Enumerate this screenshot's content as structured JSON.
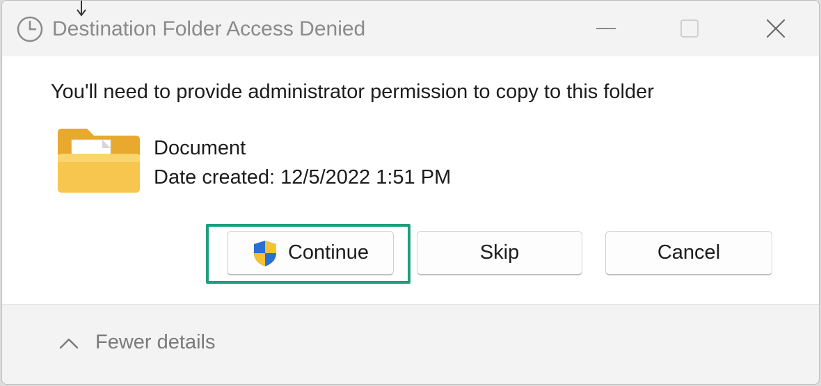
{
  "window": {
    "title": "Destination Folder Access Denied",
    "icons": {
      "title": "clock-icon",
      "minimize": "minimize-icon",
      "maximize": "maximize-icon",
      "close": "close-icon"
    }
  },
  "dialog": {
    "message": "You'll need to provide administrator permission to copy to this folder",
    "file": {
      "icon": "folder-with-word-document-icon",
      "name": "Document",
      "date_created": "Date created: 12/5/2022 1:51 PM"
    },
    "buttons": {
      "continue": "Continue",
      "skip": "Skip",
      "cancel": "Cancel"
    },
    "continue_icon": "uac-shield-icon"
  },
  "footer": {
    "toggle_label": "Fewer details",
    "toggle_icon": "chevron-up-icon"
  },
  "colors": {
    "highlight": "#1e9e7e",
    "title_text": "#8a8a8a",
    "folder": "#f5c04a"
  }
}
